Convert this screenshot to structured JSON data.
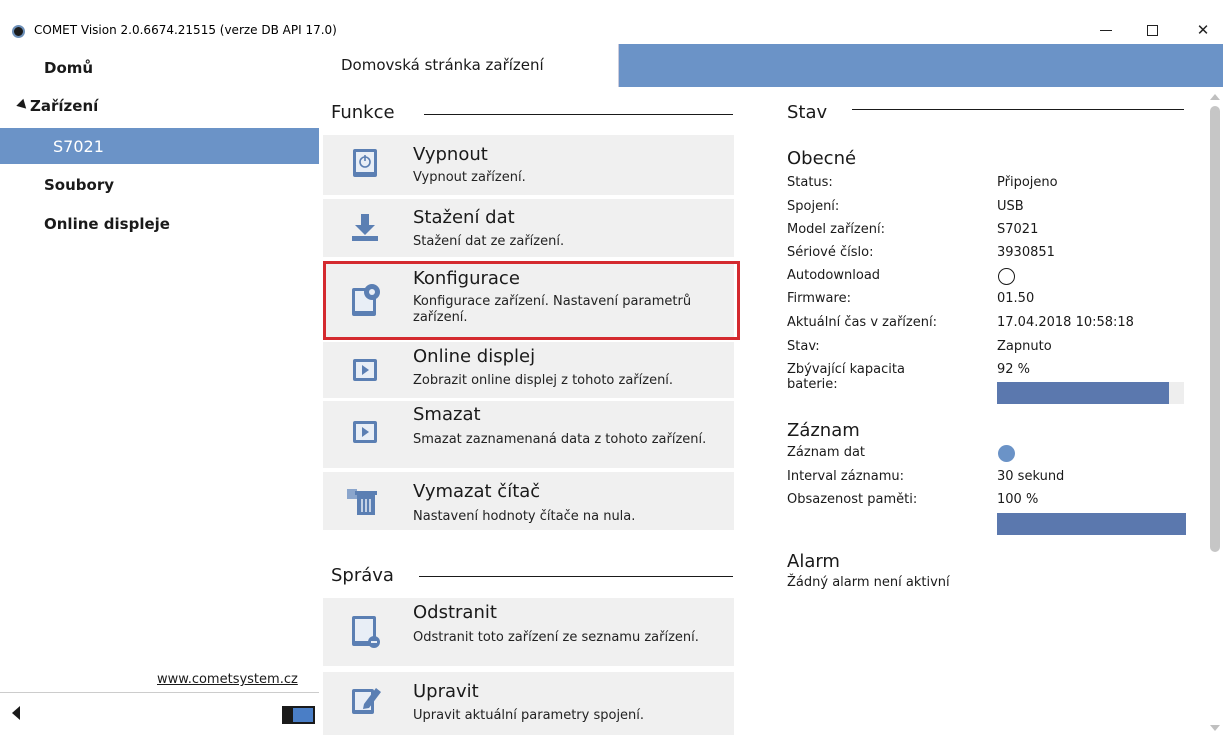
{
  "window": {
    "title": "COMET Vision 2.0.6674.21515 (verze DB API 17.0)",
    "minimize_icon": "minimize-icon",
    "maximize_icon": "maximize-icon",
    "close_label": "✕"
  },
  "sidebar": {
    "items": [
      {
        "label": "Domů"
      },
      {
        "label": "Zařízení"
      },
      {
        "label": "S7021"
      },
      {
        "label": "Soubory"
      },
      {
        "label": "Online displeje"
      }
    ],
    "website": "www.cometsystem.cz"
  },
  "tab": {
    "label": "Domovská stránka zařízení"
  },
  "functions": {
    "title": "Funkce",
    "tiles": [
      {
        "title": "Vypnout",
        "desc": "Vypnout zařízení.",
        "icon": "power-icon"
      },
      {
        "title": "Stažení dat",
        "desc": "Stažení dat ze zařízení.",
        "icon": "download-icon"
      },
      {
        "title": "Konfigurace",
        "desc": "Konfigurace zařízení. Nastavení parametrů zařízení.",
        "icon": "settings-icon"
      },
      {
        "title": "Online displej",
        "desc": "Zobrazit online displej z tohoto zařízení.",
        "icon": "play-icon"
      },
      {
        "title": "Smazat",
        "desc": "Smazat zaznamenaná data z tohoto zařízení.",
        "icon": "play-icon"
      },
      {
        "title": "Vymazat čítač",
        "desc": "Nastavení hodnoty čítače na nula.",
        "icon": "trash-icon"
      }
    ]
  },
  "management": {
    "title": "Správa",
    "tiles": [
      {
        "title": "Odstranit",
        "desc": "Odstranit toto zařízení ze seznamu zařízení.",
        "icon": "remove-device-icon"
      },
      {
        "title": "Upravit",
        "desc": "Upravit aktuální parametry spojení.",
        "icon": "edit-icon"
      }
    ]
  },
  "status": {
    "title": "Stav",
    "general": {
      "title": "Obecné",
      "rows": [
        {
          "key": "Status:",
          "value": "Připojeno"
        },
        {
          "key": "Spojení:",
          "value": "USB"
        },
        {
          "key": "Model zařízení:",
          "value": "S7021"
        },
        {
          "key": "Sériové číslo:",
          "value": "3930851"
        },
        {
          "key": "Autodownload",
          "value": ""
        },
        {
          "key": "Firmware:",
          "value": "01.50"
        },
        {
          "key": "Aktuální čas v zařízení:",
          "value": "17.04.2018 10:58:18"
        },
        {
          "key": "Stav:",
          "value": "Zapnuto"
        },
        {
          "key": "Zbývající kapacita baterie:",
          "value": "92 %"
        }
      ],
      "battery_level": 0.92
    },
    "record": {
      "title": "Záznam",
      "rows": [
        {
          "key": "Záznam dat",
          "value": ""
        },
        {
          "key": "Interval záznamu:",
          "value": "30 sekund"
        },
        {
          "key": "Obsazenost paměti:",
          "value": "100 %"
        }
      ],
      "memory_level": 1.0
    },
    "alarm": {
      "title": "Alarm",
      "text": "Žádný alarm není aktivní"
    }
  },
  "colors": {
    "accent": "#6b93c7",
    "bar": "#5b78ae",
    "highlight": "#d42a2f"
  }
}
